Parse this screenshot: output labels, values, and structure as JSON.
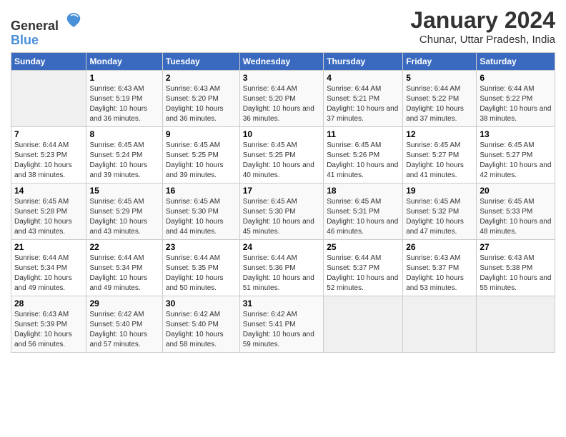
{
  "header": {
    "logo_general": "General",
    "logo_blue": "Blue",
    "month_year": "January 2024",
    "location": "Chunar, Uttar Pradesh, India"
  },
  "columns": [
    "Sunday",
    "Monday",
    "Tuesday",
    "Wednesday",
    "Thursday",
    "Friday",
    "Saturday"
  ],
  "weeks": [
    [
      {
        "day": "",
        "empty": true
      },
      {
        "day": "1",
        "sunrise": "Sunrise: 6:43 AM",
        "sunset": "Sunset: 5:19 PM",
        "daylight": "Daylight: 10 hours and 36 minutes."
      },
      {
        "day": "2",
        "sunrise": "Sunrise: 6:43 AM",
        "sunset": "Sunset: 5:20 PM",
        "daylight": "Daylight: 10 hours and 36 minutes."
      },
      {
        "day": "3",
        "sunrise": "Sunrise: 6:44 AM",
        "sunset": "Sunset: 5:20 PM",
        "daylight": "Daylight: 10 hours and 36 minutes."
      },
      {
        "day": "4",
        "sunrise": "Sunrise: 6:44 AM",
        "sunset": "Sunset: 5:21 PM",
        "daylight": "Daylight: 10 hours and 37 minutes."
      },
      {
        "day": "5",
        "sunrise": "Sunrise: 6:44 AM",
        "sunset": "Sunset: 5:22 PM",
        "daylight": "Daylight: 10 hours and 37 minutes."
      },
      {
        "day": "6",
        "sunrise": "Sunrise: 6:44 AM",
        "sunset": "Sunset: 5:22 PM",
        "daylight": "Daylight: 10 hours and 38 minutes."
      }
    ],
    [
      {
        "day": "7",
        "sunrise": "Sunrise: 6:44 AM",
        "sunset": "Sunset: 5:23 PM",
        "daylight": "Daylight: 10 hours and 38 minutes."
      },
      {
        "day": "8",
        "sunrise": "Sunrise: 6:45 AM",
        "sunset": "Sunset: 5:24 PM",
        "daylight": "Daylight: 10 hours and 39 minutes."
      },
      {
        "day": "9",
        "sunrise": "Sunrise: 6:45 AM",
        "sunset": "Sunset: 5:25 PM",
        "daylight": "Daylight: 10 hours and 39 minutes."
      },
      {
        "day": "10",
        "sunrise": "Sunrise: 6:45 AM",
        "sunset": "Sunset: 5:25 PM",
        "daylight": "Daylight: 10 hours and 40 minutes."
      },
      {
        "day": "11",
        "sunrise": "Sunrise: 6:45 AM",
        "sunset": "Sunset: 5:26 PM",
        "daylight": "Daylight: 10 hours and 41 minutes."
      },
      {
        "day": "12",
        "sunrise": "Sunrise: 6:45 AM",
        "sunset": "Sunset: 5:27 PM",
        "daylight": "Daylight: 10 hours and 41 minutes."
      },
      {
        "day": "13",
        "sunrise": "Sunrise: 6:45 AM",
        "sunset": "Sunset: 5:27 PM",
        "daylight": "Daylight: 10 hours and 42 minutes."
      }
    ],
    [
      {
        "day": "14",
        "sunrise": "Sunrise: 6:45 AM",
        "sunset": "Sunset: 5:28 PM",
        "daylight": "Daylight: 10 hours and 43 minutes."
      },
      {
        "day": "15",
        "sunrise": "Sunrise: 6:45 AM",
        "sunset": "Sunset: 5:29 PM",
        "daylight": "Daylight: 10 hours and 43 minutes."
      },
      {
        "day": "16",
        "sunrise": "Sunrise: 6:45 AM",
        "sunset": "Sunset: 5:30 PM",
        "daylight": "Daylight: 10 hours and 44 minutes."
      },
      {
        "day": "17",
        "sunrise": "Sunrise: 6:45 AM",
        "sunset": "Sunset: 5:30 PM",
        "daylight": "Daylight: 10 hours and 45 minutes."
      },
      {
        "day": "18",
        "sunrise": "Sunrise: 6:45 AM",
        "sunset": "Sunset: 5:31 PM",
        "daylight": "Daylight: 10 hours and 46 minutes."
      },
      {
        "day": "19",
        "sunrise": "Sunrise: 6:45 AM",
        "sunset": "Sunset: 5:32 PM",
        "daylight": "Daylight: 10 hours and 47 minutes."
      },
      {
        "day": "20",
        "sunrise": "Sunrise: 6:45 AM",
        "sunset": "Sunset: 5:33 PM",
        "daylight": "Daylight: 10 hours and 48 minutes."
      }
    ],
    [
      {
        "day": "21",
        "sunrise": "Sunrise: 6:44 AM",
        "sunset": "Sunset: 5:34 PM",
        "daylight": "Daylight: 10 hours and 49 minutes."
      },
      {
        "day": "22",
        "sunrise": "Sunrise: 6:44 AM",
        "sunset": "Sunset: 5:34 PM",
        "daylight": "Daylight: 10 hours and 49 minutes."
      },
      {
        "day": "23",
        "sunrise": "Sunrise: 6:44 AM",
        "sunset": "Sunset: 5:35 PM",
        "daylight": "Daylight: 10 hours and 50 minutes."
      },
      {
        "day": "24",
        "sunrise": "Sunrise: 6:44 AM",
        "sunset": "Sunset: 5:36 PM",
        "daylight": "Daylight: 10 hours and 51 minutes."
      },
      {
        "day": "25",
        "sunrise": "Sunrise: 6:44 AM",
        "sunset": "Sunset: 5:37 PM",
        "daylight": "Daylight: 10 hours and 52 minutes."
      },
      {
        "day": "26",
        "sunrise": "Sunrise: 6:43 AM",
        "sunset": "Sunset: 5:37 PM",
        "daylight": "Daylight: 10 hours and 53 minutes."
      },
      {
        "day": "27",
        "sunrise": "Sunrise: 6:43 AM",
        "sunset": "Sunset: 5:38 PM",
        "daylight": "Daylight: 10 hours and 55 minutes."
      }
    ],
    [
      {
        "day": "28",
        "sunrise": "Sunrise: 6:43 AM",
        "sunset": "Sunset: 5:39 PM",
        "daylight": "Daylight: 10 hours and 56 minutes."
      },
      {
        "day": "29",
        "sunrise": "Sunrise: 6:42 AM",
        "sunset": "Sunset: 5:40 PM",
        "daylight": "Daylight: 10 hours and 57 minutes."
      },
      {
        "day": "30",
        "sunrise": "Sunrise: 6:42 AM",
        "sunset": "Sunset: 5:40 PM",
        "daylight": "Daylight: 10 hours and 58 minutes."
      },
      {
        "day": "31",
        "sunrise": "Sunrise: 6:42 AM",
        "sunset": "Sunset: 5:41 PM",
        "daylight": "Daylight: 10 hours and 59 minutes."
      },
      {
        "day": "",
        "empty": true
      },
      {
        "day": "",
        "empty": true
      },
      {
        "day": "",
        "empty": true
      }
    ]
  ]
}
